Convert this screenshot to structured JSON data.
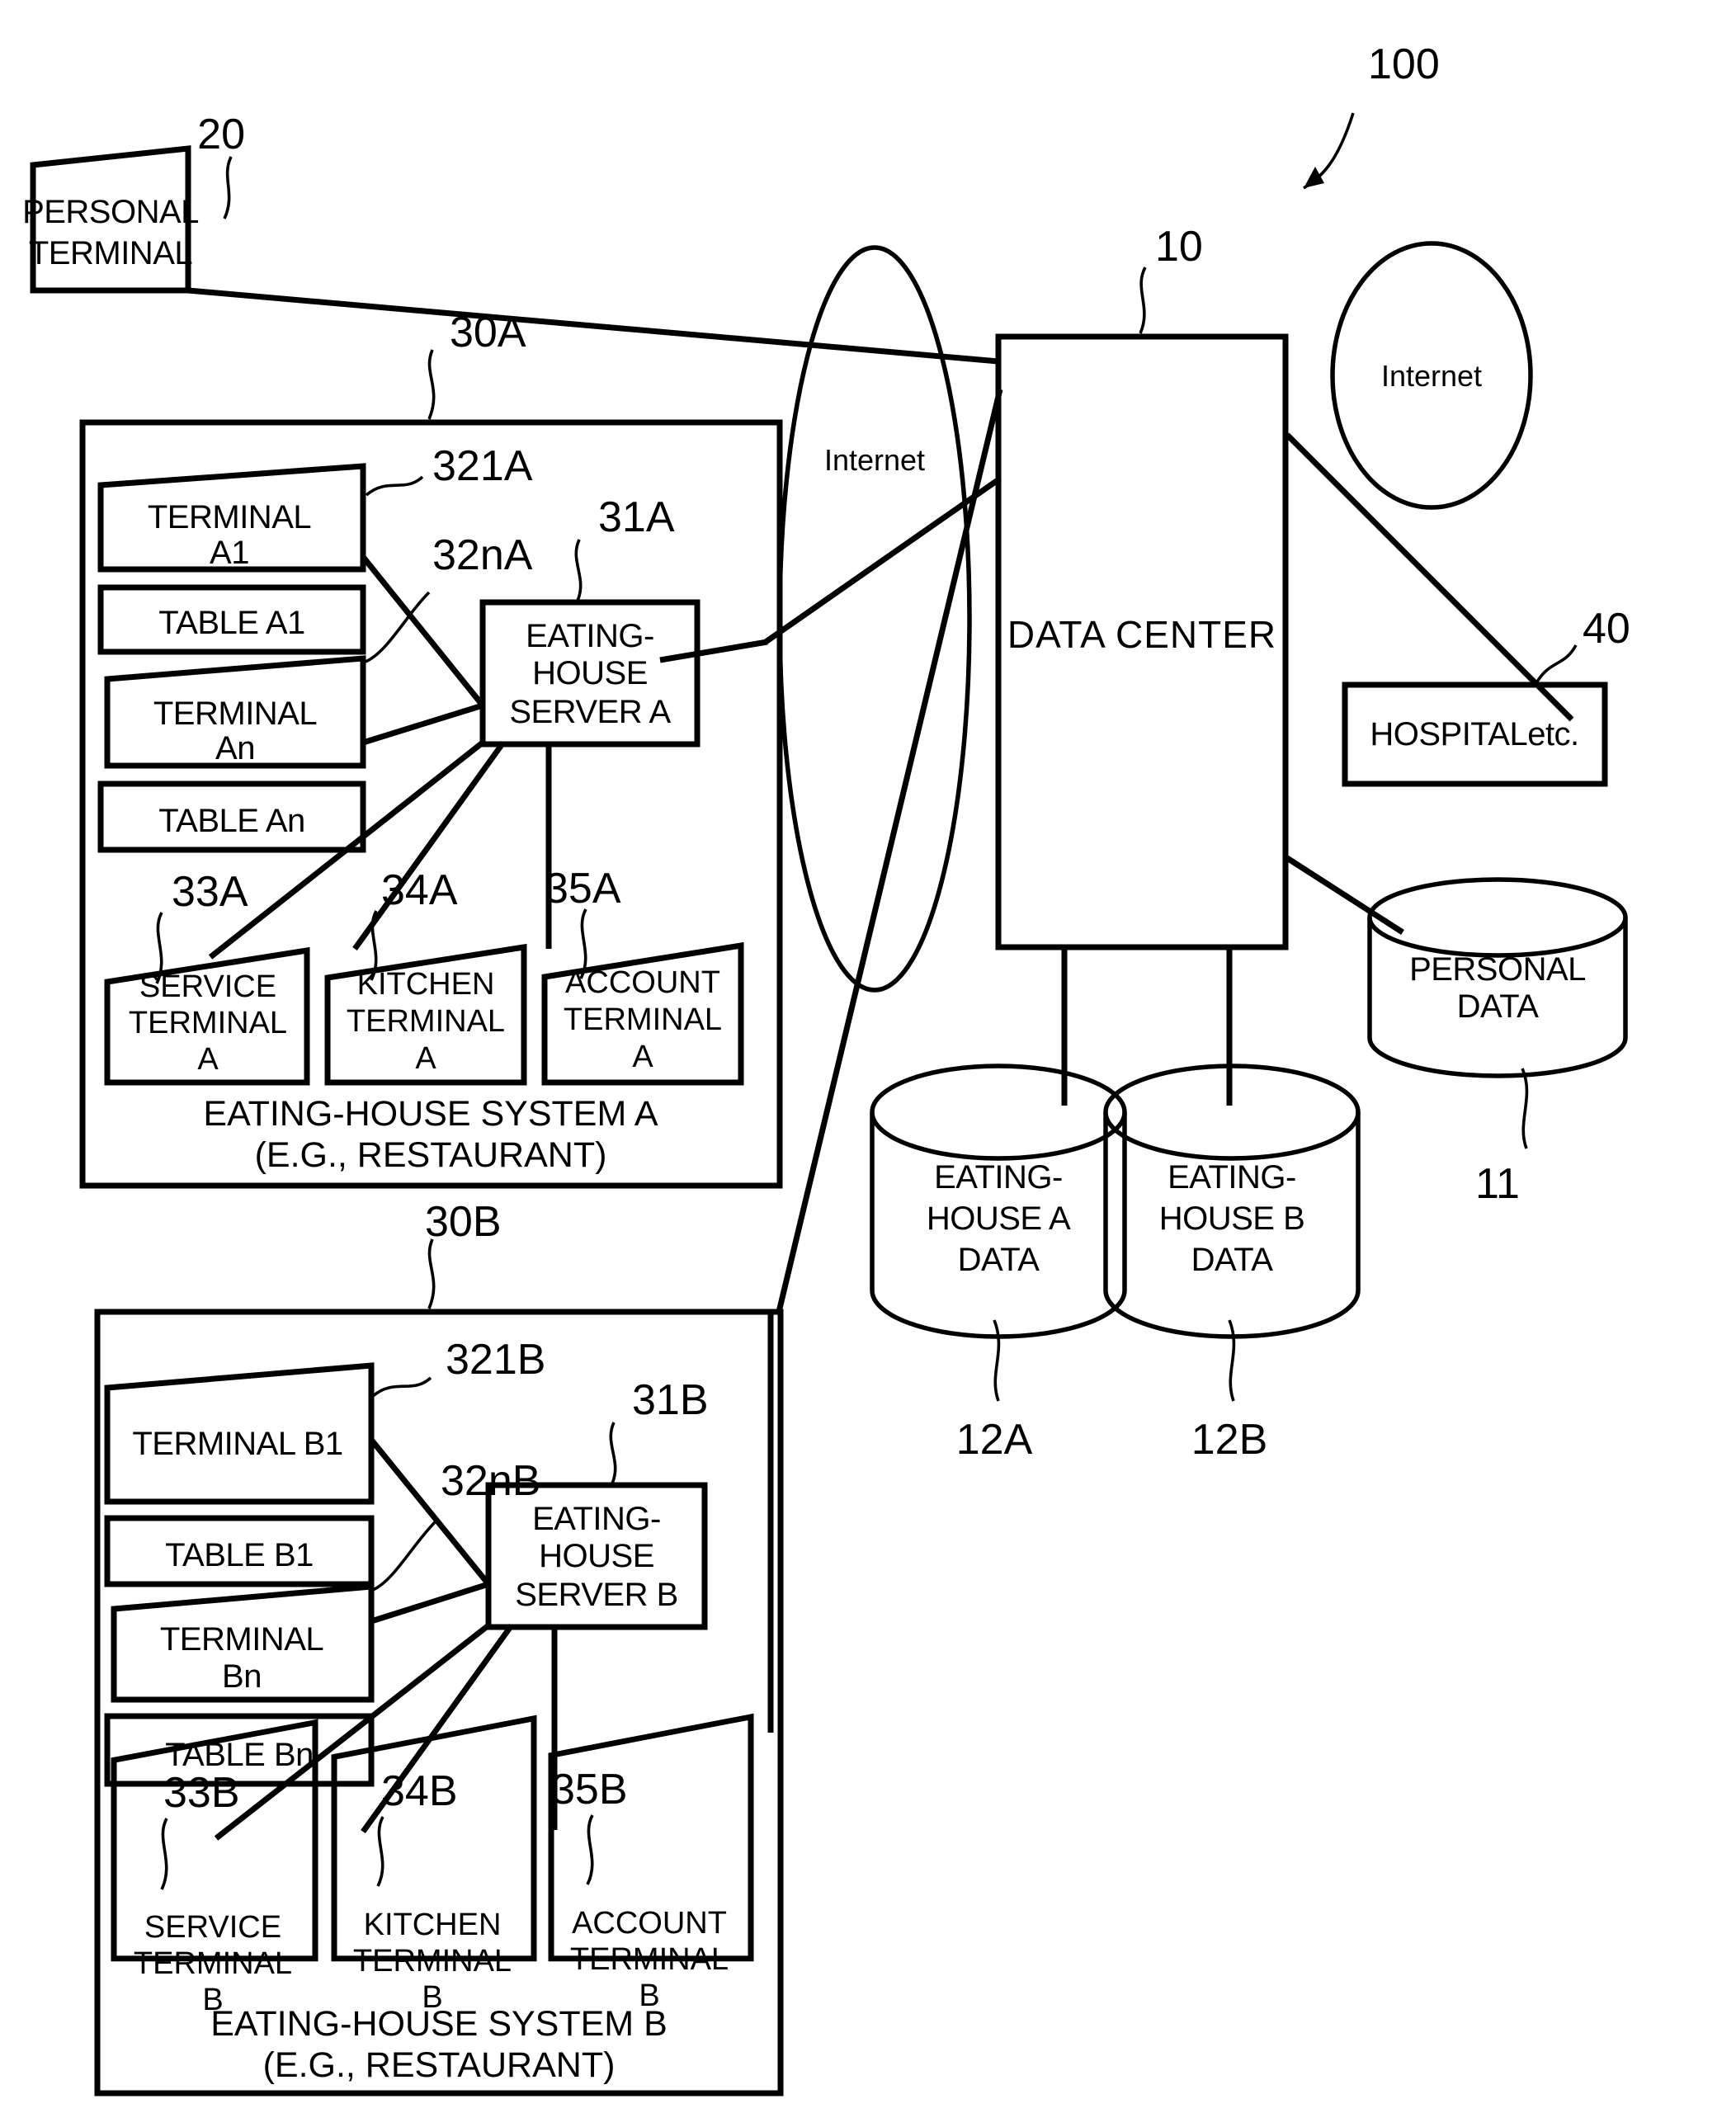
{
  "figure": {
    "type": "patent-block-diagram",
    "system_ref": "100"
  },
  "refs": {
    "system": "100",
    "data_center": "10",
    "personal_data": "11",
    "eating_house_a_data": "12A",
    "eating_house_b_data": "12B",
    "personal_terminal": "20",
    "system_a": "30A",
    "system_b": "30B",
    "server_a": "31A",
    "server_b": "31B",
    "terminal_a1": "321A",
    "terminal_an": "32nA",
    "terminal_b1": "321B",
    "terminal_bn": "32nB",
    "service_terminal_a": "33A",
    "service_terminal_b": "33B",
    "kitchen_terminal_a": "34A",
    "kitchen_terminal_b": "34B",
    "account_terminal_a": "35A",
    "account_terminal_b": "35B",
    "hospital": "40"
  },
  "nodes": {
    "personal_terminal": {
      "line1": "PERSONAL",
      "line2": "TERMINAL"
    },
    "internet_left": "Internet",
    "internet_right": "Internet",
    "data_center": "DATA CENTER",
    "hospital": "HOSPITALetc.",
    "personal_data": {
      "line1": "PERSONAL",
      "line2": "DATA"
    },
    "eating_house_a_data": {
      "line1": "EATING-",
      "line2": "HOUSE A",
      "line3": "DATA"
    },
    "eating_house_b_data": {
      "line1": "EATING-",
      "line2": "HOUSE B",
      "line3": "DATA"
    }
  },
  "system_a": {
    "caption_line1": "EATING-HOUSE SYSTEM A",
    "caption_line2": "(E.G., RESTAURANT)",
    "terminal_1": {
      "line1": "TERMINAL",
      "line2": "A1"
    },
    "table_1": "TABLE A1",
    "terminal_n": {
      "line1": "TERMINAL",
      "line2": "An"
    },
    "table_n": "TABLE An",
    "server": {
      "line1": "EATING-",
      "line2": "HOUSE",
      "line3": "SERVER A"
    },
    "service_terminal": {
      "line1": "SERVICE",
      "line2": "TERMINAL",
      "line3": "A"
    },
    "kitchen_terminal": {
      "line1": "KITCHEN",
      "line2": "TERMINAL",
      "line3": "A"
    },
    "account_terminal": {
      "line1": "ACCOUNT",
      "line2": "TERMINAL",
      "line3": "A"
    }
  },
  "system_b": {
    "caption_line1": "EATING-HOUSE SYSTEM B",
    "caption_line2": "(E.G., RESTAURANT)",
    "terminal_1": {
      "line1": "TERMINAL B1"
    },
    "table_1": "TABLE B1",
    "terminal_n": {
      "line1": "TERMINAL",
      "line2": "Bn"
    },
    "table_n": "TABLE Bn",
    "server": {
      "line1": "EATING-",
      "line2": "HOUSE",
      "line3": "SERVER B"
    },
    "service_terminal": {
      "line1": "SERVICE",
      "line2": "TERMINAL",
      "line3": "B"
    },
    "kitchen_terminal": {
      "line1": "KITCHEN",
      "line2": "TERMINAL",
      "line3": "B"
    },
    "account_terminal": {
      "line1": "ACCOUNT",
      "line2": "TERMINAL",
      "line3": "B"
    }
  },
  "colors": {
    "ink": "#000000",
    "paper": "#ffffff"
  }
}
